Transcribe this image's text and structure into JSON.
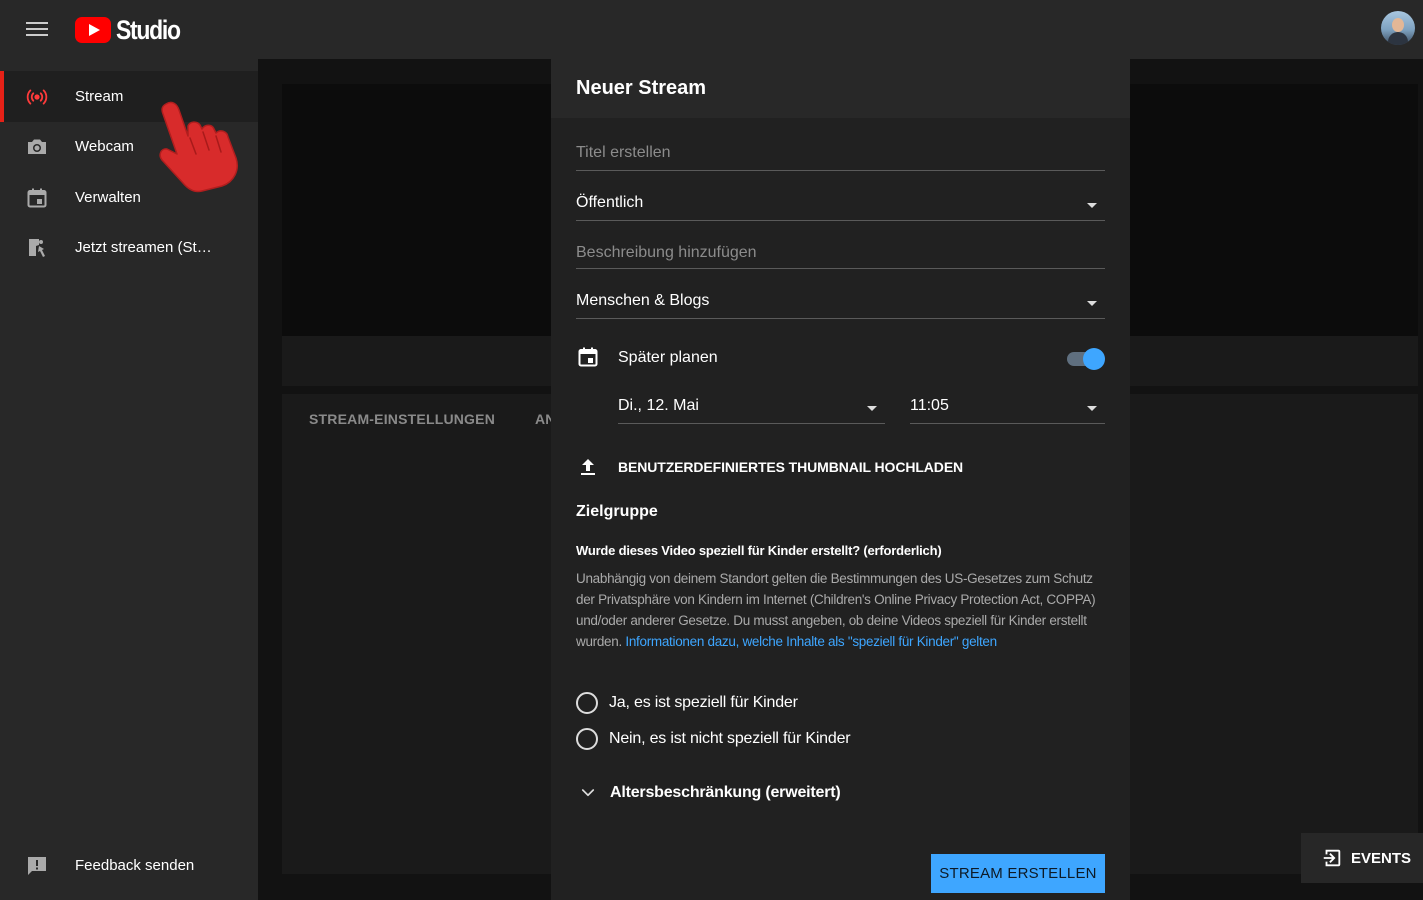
{
  "app": {
    "logo_text": "Studio"
  },
  "sidebar": {
    "items": [
      {
        "label": "Stream",
        "icon": "broadcast-icon",
        "active": true
      },
      {
        "label": "Webcam",
        "icon": "camera-icon"
      },
      {
        "label": "Verwalten",
        "icon": "calendar-icon"
      },
      {
        "label": "Jetzt streamen (Studio)",
        "icon": "encoder-icon"
      }
    ],
    "feedback_label": "Feedback senden"
  },
  "background": {
    "tabs": [
      "STREAM-EINSTELLUNGEN",
      "AN"
    ]
  },
  "events": {
    "label": "EVENTS"
  },
  "dialog": {
    "title": "Neuer Stream",
    "title_field": {
      "placeholder": "Titel erstellen"
    },
    "visibility": {
      "value": "Öffentlich"
    },
    "description_field": {
      "placeholder": "Beschreibung hinzufügen"
    },
    "category": {
      "value": "Menschen & Blogs"
    },
    "schedule": {
      "label": "Später planen",
      "enabled": true,
      "date": "Di., 12. Mai",
      "time": "11:05"
    },
    "thumbnail_label": "BENUTZERDEFINIERTES THUMBNAIL HOCHLADEN",
    "audience": {
      "heading": "Zielgruppe",
      "question": "Wurde dieses Video speziell für Kinder erstellt? (erforderlich)",
      "text": "Unabhängig von deinem Standort gelten die Bestimmungen des US-Gesetzes zum Schutz der Privatsphäre von Kindern im Internet (Children's Online Privacy Protection Act, COPPA) und/oder anderer Gesetze. Du musst angeben, ob deine Videos speziell für Kinder erstellt wurden.",
      "link": "Informationen dazu, welche Inhalte als \"speziell für Kinder\" gelten",
      "option_yes": "Ja, es ist speziell für Kinder",
      "option_no": "Nein, es ist nicht speziell für Kinder"
    },
    "age_restriction_label": "Altersbeschränkung (erweitert)",
    "create_button": "STREAM ERSTELLEN"
  },
  "colors": {
    "accent": "#3ea6ff",
    "brand_red": "#ff0000",
    "active_bar": "#e62117"
  }
}
